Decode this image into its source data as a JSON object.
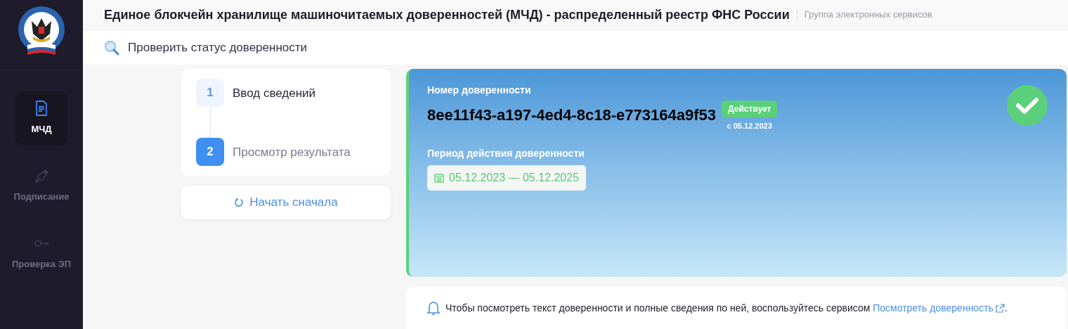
{
  "header": {
    "title": "Единое блокчейн хранилище машиночитаемых доверенностей (МЧД) - распределенный реестр ФНС России",
    "subtitle": "Группа электронных сервисов"
  },
  "sidebar": {
    "items": [
      {
        "kind": "document",
        "label": "МЧД",
        "selected": true
      },
      {
        "kind": "pen",
        "label": "Подписание",
        "selected": false
      },
      {
        "kind": "key",
        "label": "Проверка ЭП",
        "selected": false
      }
    ]
  },
  "page_title": "Проверить статус доверенности",
  "steps": [
    {
      "number": "1",
      "label": "Ввод сведений",
      "selected": false
    },
    {
      "number": "2",
      "label": "Просмотр результата",
      "selected": true
    }
  ],
  "restart_button": "Начать сначала",
  "result": {
    "number_label": "Номер доверенности",
    "number": "8ee11f43-a197-4ed4-8c18-e773164a9f53",
    "status": "Действует",
    "status_since": "с 05.12.2023",
    "valid": true,
    "period_label": "Период действия доверенности",
    "period": "05.12.2023 — 05.12.2025"
  },
  "notice": {
    "text": "Чтобы посмотреть текст доверенности и полные сведения по ней, воспользуйтесь сервисом",
    "link": "Посмотреть доверенность",
    "end": "."
  }
}
